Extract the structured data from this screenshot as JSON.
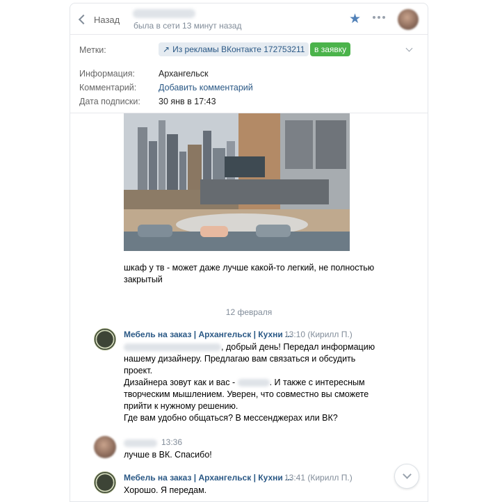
{
  "header": {
    "back_label": "Назад",
    "status": "была в сети 13 минут назад"
  },
  "info": {
    "labels_title": "Метки:",
    "tag_text": "Из рекламы ВКонтакте 172753211",
    "tag_action": "в заявку",
    "info_label": "Информация:",
    "info_value": "Архангельск",
    "comment_label": "Комментарий:",
    "comment_value": "Добавить комментарий",
    "sub_label": "Дата подписки:",
    "sub_value": "30 янв в 17:43"
  },
  "chat": {
    "photo_caption_1": "шкаф у тв - может даже лучше какой-то легкий, не полностью",
    "photo_caption_2": "закрытый",
    "date_separator": "12 февраля",
    "messages": [
      {
        "sender": "Мебель на заказ | Архангельск | Кухни ...",
        "time": "13:10 (Кирилл П.)",
        "lines": [
          ", добрый день! Передал информацию",
          "нашему дизайнеру. Предлагаю вам связаться и обсудить",
          "проект.",
          "Дизайнера зовут как и вас - ",
          ". И также с интересным",
          "творческим мышлением. Уверен, что совместно вы сможете",
          "прийти к нужному решению.",
          "Где вам удобно общаться? В мессенджерах или ВК?"
        ]
      },
      {
        "time": "13:36",
        "lines": [
          "лучше в ВК. Спасибо!"
        ]
      },
      {
        "sender": "Мебель на заказ | Архангельск | Кухни ...",
        "time": "13:41 (Кирилл П.)",
        "lines": [
          "Хорошо. Я передам."
        ]
      }
    ]
  },
  "colors": {
    "accent": "#5181b8",
    "link": "#2a5885",
    "green": "#4bb34b",
    "muted": "#818c99"
  },
  "icons": [
    "chevron-left-icon",
    "star-icon",
    "more-icon",
    "external-link-icon",
    "chevron-down-icon"
  ]
}
